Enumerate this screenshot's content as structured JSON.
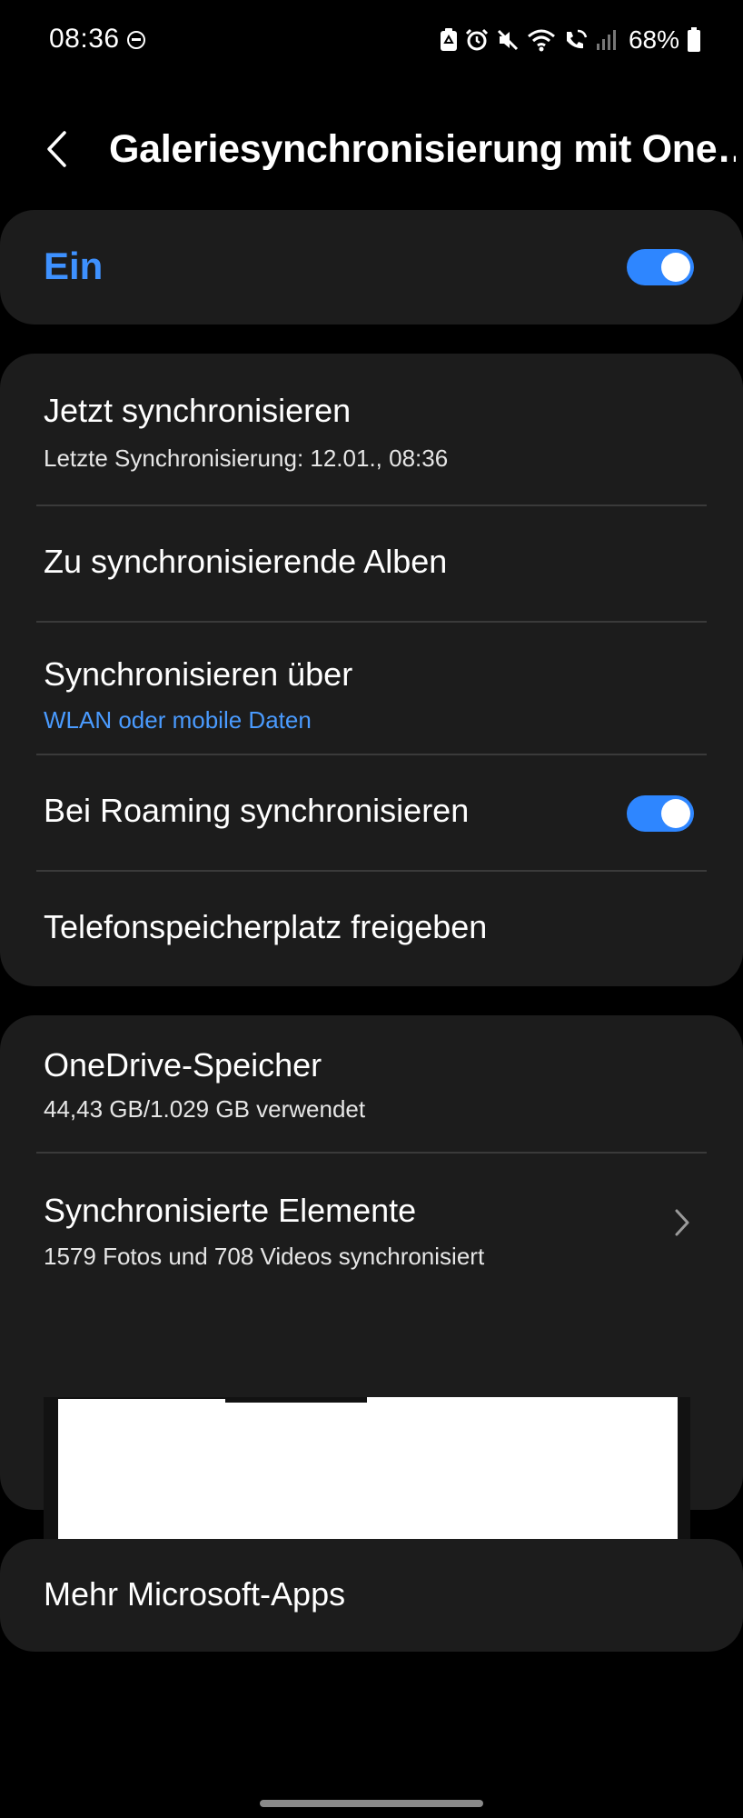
{
  "status_bar": {
    "time": "08:36",
    "battery_percent": "68%",
    "icons": [
      "do-not-disturb-icon",
      "recycle-notification-icon",
      "alarm-icon",
      "mute-icon",
      "wifi-icon",
      "wifi-calling-icon",
      "signal-icon",
      "battery-icon"
    ]
  },
  "header": {
    "title": "Galeriesynchronisierung mit One…"
  },
  "main_toggle": {
    "label": "Ein",
    "state": "on"
  },
  "sync_settings": {
    "sync_now": {
      "title": "Jetzt synchronisieren",
      "subtitle": "Letzte Synchronisierung: 12.01., 08:36"
    },
    "albums": {
      "title": "Zu synchronisierende Alben"
    },
    "sync_via": {
      "title": "Synchronisieren über",
      "value": "WLAN oder mobile Daten"
    },
    "roaming": {
      "title": "Bei Roaming synchronisieren",
      "state": "on"
    },
    "free_storage": {
      "title": "Telefonspeicherplatz freigeben"
    }
  },
  "onedrive": {
    "storage": {
      "title": "OneDrive-Speicher",
      "subtitle": "44,43 GB/1.029 GB verwendet"
    },
    "synced_items": {
      "title": "Synchronisierte Elemente",
      "subtitle": "1579 Fotos und 708 Videos synchronisiert"
    }
  },
  "more_apps": {
    "title": "Mehr Microsoft-Apps"
  },
  "colors": {
    "background": "#000000",
    "card": "#1c1c1c",
    "accent": "#3e91ff",
    "toggle_on": "#2e86ff",
    "divider": "#3a3a3a"
  }
}
